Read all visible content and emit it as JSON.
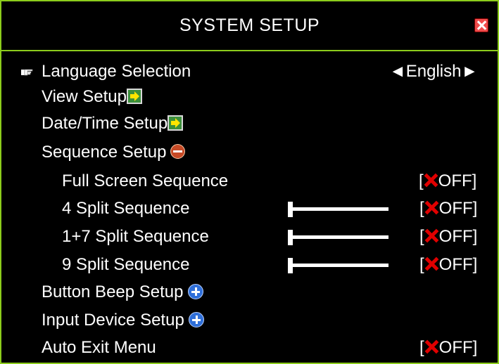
{
  "title": "SYSTEM SETUP",
  "menu": {
    "language": {
      "label": "Language Selection",
      "value": "◄English►"
    },
    "view": {
      "label": "View Setup"
    },
    "datetime": {
      "label": "Date/Time Setup"
    },
    "sequence": {
      "label": "Sequence Setup"
    },
    "full_screen": {
      "label": "Full Screen Sequence",
      "bracket_open": "[",
      "value": "OFF]"
    },
    "split4": {
      "label": "4 Split Sequence",
      "bracket_open": "[",
      "value": "OFF]"
    },
    "split17": {
      "label": "1+7 Split Sequence",
      "bracket_open": "[",
      "value": "OFF]"
    },
    "split9": {
      "label": "9 Split Sequence",
      "bracket_open": "[",
      "value": "OFF]"
    },
    "beep": {
      "label": "Button Beep Setup"
    },
    "input": {
      "label": "Input Device Setup"
    },
    "autoexit": {
      "label": "Auto Exit Menu",
      "bracket_open": "[",
      "value": "OFF]"
    }
  },
  "icons": {
    "pointer": "pointing-hand-icon",
    "submenu": "green-arrow-icon",
    "collapse": "minus-circle-icon",
    "expand": "plus-circle-icon",
    "off": "red-x-icon",
    "close": "close-icon"
  },
  "colors": {
    "frame": "#8ccc1c",
    "background": "#000000",
    "text": "#ffffff",
    "off_x": "#e00000"
  }
}
